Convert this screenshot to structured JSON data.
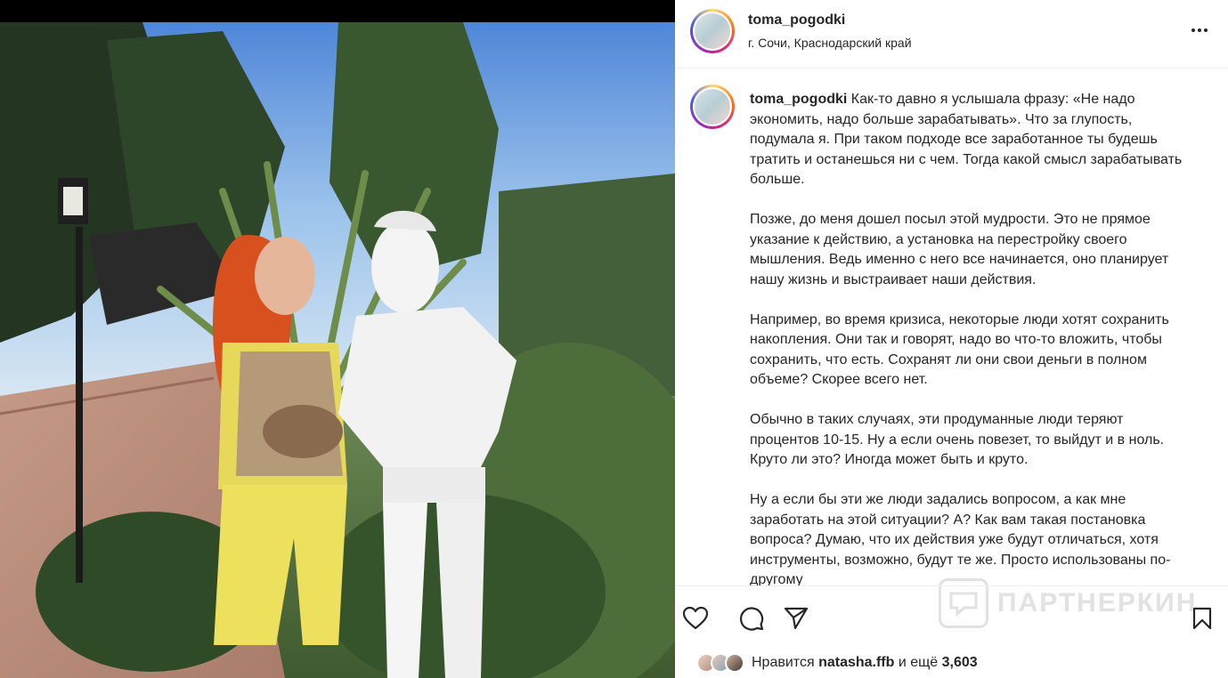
{
  "post": {
    "username": "toma_pogodki",
    "location": "г. Сочи, Краснодарский край",
    "caption_paragraphs": [
      "Как-то давно я услышала фразу: «Не надо экономить, надо больше зарабатывать». Что за глупость, подумала я. При таком подходе все заработанное ты будешь тратить и останешься ни с чем. Тогда какой смысл зарабатывать больше.",
      "Позже, до меня дошел посыл этой мудрости. Это не прямое указание к действию, а установка на перестройку своего мышления. Ведь именно с него все начинается, оно планирует нашу жизнь и выстраивает наши действия.",
      "Например, во время кризиса, некоторые люди хотят сохранить накопления. Они так и говорят, надо во что-то вложить, чтобы сохранить, что есть. Сохранят ли они свои деньги в полном объеме? Скорее всего нет.",
      "Обычно в таких случаях, эти продуманные люди теряют процентов 10-15. Ну а если очень повезет, то выйдут и в ноль. Круто ли это? Иногда может быть и круто.",
      "Ну а если бы эти же люди задались вопросом, а как мне заработать на этой ситуации? А? Как вам такая постановка вопроса? Думаю, что их действия уже будут отличаться, хотя инструменты, возможно, будут те же. Просто использованы по-другому"
    ],
    "likes_prefix": "Нравится",
    "likes_user": "natasha.ffb",
    "likes_mid": "и ещё",
    "likes_count": "3,603"
  },
  "watermark": {
    "text": "ПАРТНЕРКИН"
  },
  "icons": {
    "more": "more-options-icon",
    "like": "heart-icon",
    "comment": "comment-icon",
    "share": "share-icon",
    "save": "bookmark-icon"
  },
  "colors": {
    "text": "#262626",
    "divider": "#efefef",
    "story_ring": [
      "#feda75",
      "#fa7e1e",
      "#d62976",
      "#962fbf",
      "#4f5bd5"
    ]
  }
}
